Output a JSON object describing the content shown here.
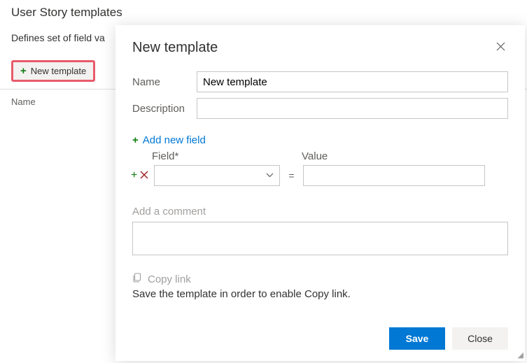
{
  "page": {
    "title": "User Story templates",
    "subtitle": "Defines set of field va",
    "newTemplateBtn": "New template",
    "colName": "Name"
  },
  "dialog": {
    "title": "New template",
    "nameLabel": "Name",
    "nameValue": "New template",
    "descLabel": "Description",
    "descValue": "",
    "addField": "Add new field",
    "fieldHeader": "Field*",
    "valueHeader": "Value",
    "equals": "=",
    "commentLabel": "Add a comment",
    "commentValue": "",
    "copyLink": "Copy link",
    "copyNote": "Save the template in order to enable Copy link.",
    "saveBtn": "Save",
    "closeBtn": "Close"
  }
}
